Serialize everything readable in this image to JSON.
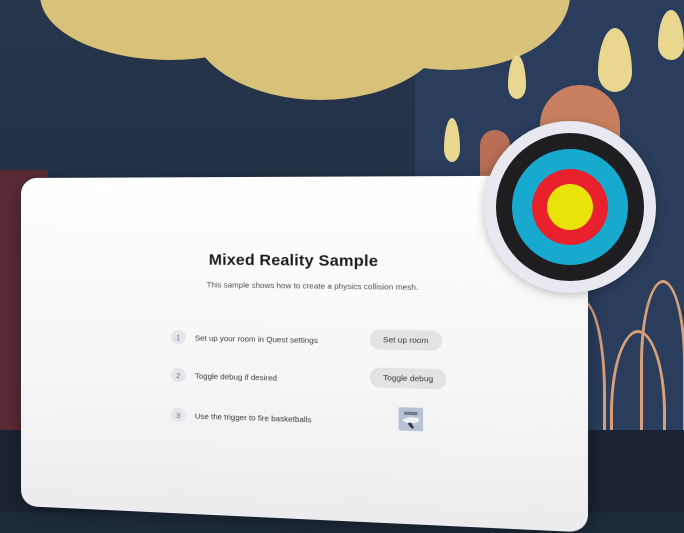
{
  "panel": {
    "title": "Mixed Reality Sample",
    "subtitle": "This sample shows how to create a physics collision mesh.",
    "steps": [
      {
        "number": "1",
        "text": "Set up your room in Quest settings",
        "button": "Set up room"
      },
      {
        "number": "2",
        "text": "Toggle debug if desired",
        "button": "Toggle debug"
      },
      {
        "number": "3",
        "text": "Use the trigger to fire basketballs",
        "icon": "controller-trigger-icon"
      }
    ]
  },
  "target": {
    "ring_colors": [
      "#1e1e20",
      "#18a9cf",
      "#e8212c",
      "#e9e309"
    ]
  }
}
